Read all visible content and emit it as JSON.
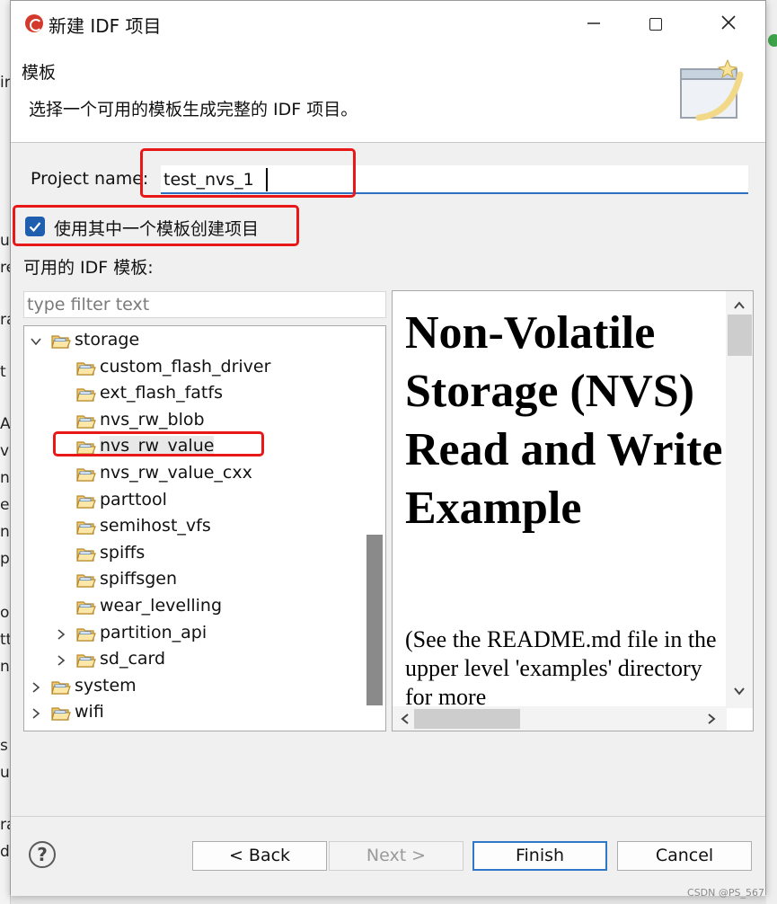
{
  "window": {
    "title": "新建 IDF 项目"
  },
  "header": {
    "page_title": "模板",
    "description": "选择一个可用的模板生成完整的 IDF 项目。"
  },
  "form": {
    "project_name_label": "Project name:",
    "project_name_value": "test_nvs_1",
    "use_template_checked": true,
    "use_template_label": "使用其中一个模板创建项目",
    "available_label": "可用的 IDF 模板:",
    "filter_placeholder": "type filter text"
  },
  "tree": [
    {
      "label": "storage",
      "level": 0,
      "expander": "expanded",
      "selected": false
    },
    {
      "label": "custom_flash_driver",
      "level": 1,
      "expander": "none",
      "selected": false
    },
    {
      "label": "ext_flash_fatfs",
      "level": 1,
      "expander": "none",
      "selected": false
    },
    {
      "label": "nvs_rw_blob",
      "level": 1,
      "expander": "none",
      "selected": false
    },
    {
      "label": "nvs_rw_value",
      "level": 1,
      "expander": "none",
      "selected": true
    },
    {
      "label": "nvs_rw_value_cxx",
      "level": 1,
      "expander": "none",
      "selected": false
    },
    {
      "label": "parttool",
      "level": 1,
      "expander": "none",
      "selected": false
    },
    {
      "label": "semihost_vfs",
      "level": 1,
      "expander": "none",
      "selected": false
    },
    {
      "label": "spiffs",
      "level": 1,
      "expander": "none",
      "selected": false
    },
    {
      "label": "spiffsgen",
      "level": 1,
      "expander": "none",
      "selected": false
    },
    {
      "label": "wear_levelling",
      "level": 1,
      "expander": "none",
      "selected": false
    },
    {
      "label": "partition_api",
      "level": 1,
      "expander": "collapsed",
      "selected": false
    },
    {
      "label": "sd_card",
      "level": 1,
      "expander": "collapsed",
      "selected": false
    },
    {
      "label": "system",
      "level": 0,
      "expander": "collapsed",
      "selected": false
    },
    {
      "label": "wifi",
      "level": 0,
      "expander": "collapsed",
      "selected": false
    }
  ],
  "readme": {
    "heading": "Non-Volatile Storage (NVS) Read and Write Example",
    "body": "(See the README.md file in the upper level 'examples' directory for more"
  },
  "buttons": {
    "back": "< Back",
    "next": "Next >",
    "finish": "Finish",
    "cancel": "Cancel"
  },
  "background_fragments": [
    "ir",
    "u",
    "re",
    "ra",
    "t",
    "A",
    "ve",
    "n",
    "es",
    "n",
    "p",
    "on",
    "tt",
    "n",
    "s",
    "u",
    "ra",
    "d"
  ],
  "watermark": "CSDN @PS_567",
  "colors": {
    "accent": "#1f5eae",
    "focus_border": "#2f78c8",
    "annotation_red": "#e81818"
  },
  "icons": {
    "folder": "folder-open-icon",
    "help": "help-icon",
    "checkbox": "checkmark-icon"
  }
}
